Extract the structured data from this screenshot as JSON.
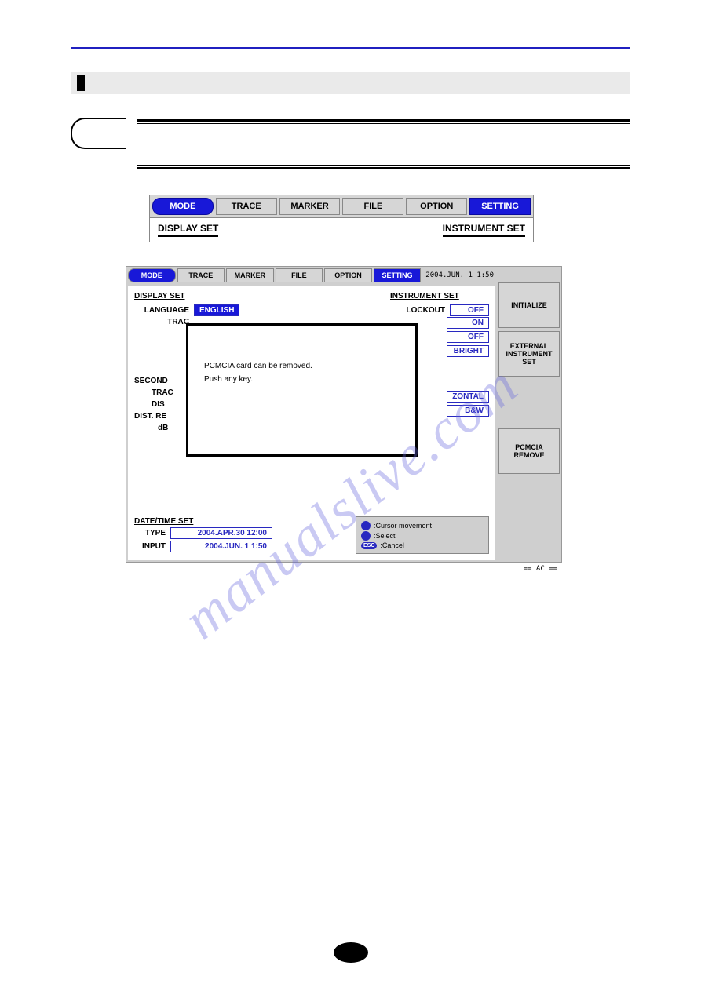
{
  "watermark": "manualslive.com",
  "fig1": {
    "tabs": [
      "MODE",
      "TRACE",
      "MARKER",
      "FILE",
      "OPTION",
      "SETTING"
    ],
    "left": "DISPLAY SET",
    "right": "INSTRUMENT SET"
  },
  "fig2": {
    "tabs": [
      "MODE",
      "TRACE",
      "MARKER",
      "FILE",
      "OPTION",
      "SETTING"
    ],
    "clock": "2004.JUN. 1  1:50",
    "display_set": {
      "heading": "DISPLAY SET",
      "language": {
        "k": "LANGUAGE",
        "v": "ENGLISH"
      },
      "trac": "TRAC"
    },
    "instrument_set": {
      "heading": "INSTRUMENT SET",
      "lockout": {
        "k": "LOCKOUT",
        "v": "OFF"
      }
    },
    "side": [
      "ON",
      "OFF",
      "BRIGHT",
      "ZONTAL",
      "B&W"
    ],
    "left_labels": [
      "SECOND",
      "TRAC",
      "DIS",
      "DIST. RE",
      "dB"
    ],
    "dialog": {
      "line1": "PCMCIA card can be removed.",
      "line2": "Push any key."
    },
    "datetime": {
      "heading": "DATE/TIME SET",
      "type": {
        "k": "TYPE",
        "v": "2004.APR.30  12:00"
      },
      "input": {
        "k": "INPUT",
        "v": "2004.JUN. 1   1:50"
      }
    },
    "hints": [
      ":Cursor movement",
      ":Select",
      ":Cancel"
    ],
    "esc": "ESC",
    "softkeys": [
      "INITIALIZE",
      "EXTERNAL INSTRUMENT SET",
      "PCMCIA REMOVE"
    ],
    "ac": "== AC =="
  }
}
